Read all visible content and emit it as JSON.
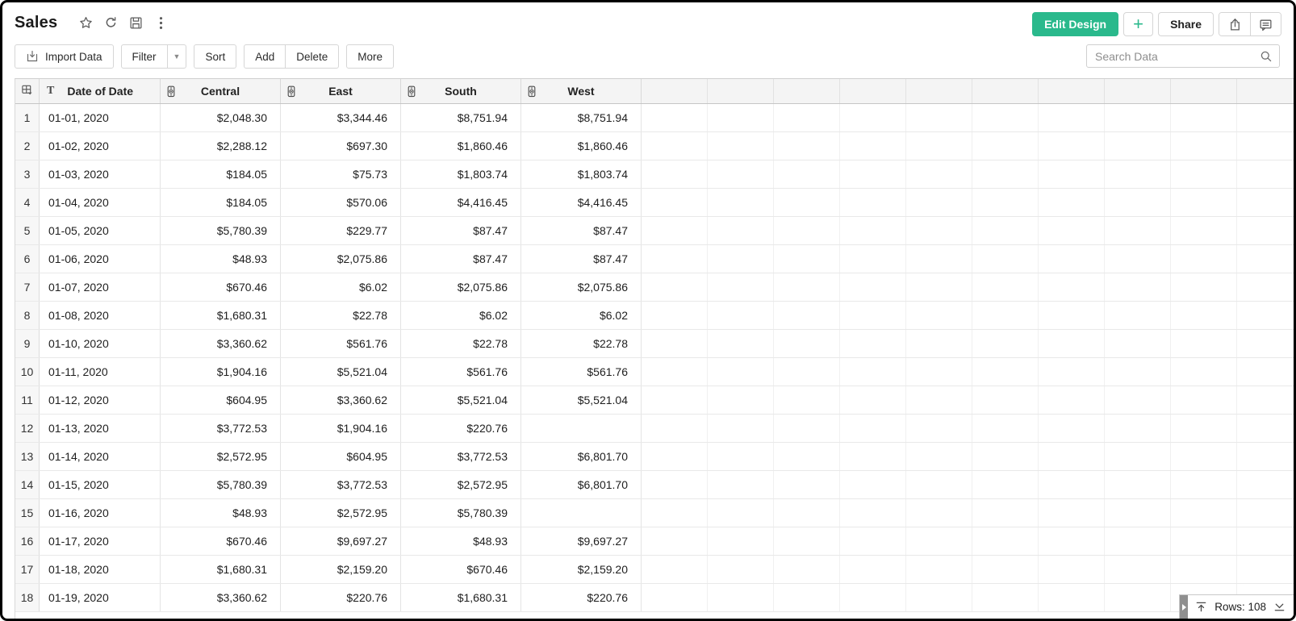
{
  "title": "Sales",
  "title_icons": [
    "star-icon",
    "refresh-icon",
    "save-icon",
    "kebab-menu-icon"
  ],
  "actions": {
    "edit_design": "Edit Design",
    "plus": "+",
    "share": "Share"
  },
  "toolbar": {
    "import": "Import Data",
    "filter": "Filter",
    "sort": "Sort",
    "add": "Add",
    "delete": "Delete",
    "more": "More"
  },
  "search": {
    "placeholder": "Search Data"
  },
  "status": {
    "rows_label": "Rows: 108"
  },
  "colors": {
    "accent_green": "#2ab98c"
  },
  "table": {
    "date_column": {
      "type_glyph": "T",
      "label": "Date of Date"
    },
    "currency_columns": [
      "Central",
      "East",
      "South",
      "West"
    ],
    "empty_column_count": 10,
    "rows": [
      {
        "n": "1",
        "date": "01-01, 2020",
        "values": [
          "$2,048.30",
          "$3,344.46",
          "$8,751.94",
          "$8,751.94"
        ]
      },
      {
        "n": "2",
        "date": "01-02, 2020",
        "values": [
          "$2,288.12",
          "$697.30",
          "$1,860.46",
          "$1,860.46"
        ]
      },
      {
        "n": "3",
        "date": "01-03, 2020",
        "values": [
          "$184.05",
          "$75.73",
          "$1,803.74",
          "$1,803.74"
        ]
      },
      {
        "n": "4",
        "date": "01-04, 2020",
        "values": [
          "$184.05",
          "$570.06",
          "$4,416.45",
          "$4,416.45"
        ]
      },
      {
        "n": "5",
        "date": "01-05, 2020",
        "values": [
          "$5,780.39",
          "$229.77",
          "$87.47",
          "$87.47"
        ]
      },
      {
        "n": "6",
        "date": "01-06, 2020",
        "values": [
          "$48.93",
          "$2,075.86",
          "$87.47",
          "$87.47"
        ]
      },
      {
        "n": "7",
        "date": "01-07, 2020",
        "values": [
          "$670.46",
          "$6.02",
          "$2,075.86",
          "$2,075.86"
        ]
      },
      {
        "n": "8",
        "date": "01-08, 2020",
        "values": [
          "$1,680.31",
          "$22.78",
          "$6.02",
          "$6.02"
        ]
      },
      {
        "n": "9",
        "date": "01-10, 2020",
        "values": [
          "$3,360.62",
          "$561.76",
          "$22.78",
          "$22.78"
        ]
      },
      {
        "n": "10",
        "date": "01-11, 2020",
        "values": [
          "$1,904.16",
          "$5,521.04",
          "$561.76",
          "$561.76"
        ]
      },
      {
        "n": "11",
        "date": "01-12, 2020",
        "values": [
          "$604.95",
          "$3,360.62",
          "$5,521.04",
          "$5,521.04"
        ]
      },
      {
        "n": "12",
        "date": "01-13, 2020",
        "values": [
          "$3,772.53",
          "$1,904.16",
          "$220.76",
          ""
        ]
      },
      {
        "n": "13",
        "date": "01-14, 2020",
        "values": [
          "$2,572.95",
          "$604.95",
          "$3,772.53",
          "$6,801.70"
        ]
      },
      {
        "n": "14",
        "date": "01-15, 2020",
        "values": [
          "$5,780.39",
          "$3,772.53",
          "$2,572.95",
          "$6,801.70"
        ]
      },
      {
        "n": "15",
        "date": "01-16, 2020",
        "values": [
          "$48.93",
          "$2,572.95",
          "$5,780.39",
          ""
        ]
      },
      {
        "n": "16",
        "date": "01-17, 2020",
        "values": [
          "$670.46",
          "$9,697.27",
          "$48.93",
          "$9,697.27"
        ]
      },
      {
        "n": "17",
        "date": "01-18, 2020",
        "values": [
          "$1,680.31",
          "$2,159.20",
          "$670.46",
          "$2,159.20"
        ]
      },
      {
        "n": "18",
        "date": "01-19, 2020",
        "values": [
          "$3,360.62",
          "$220.76",
          "$1,680.31",
          "$220.76"
        ]
      }
    ]
  }
}
